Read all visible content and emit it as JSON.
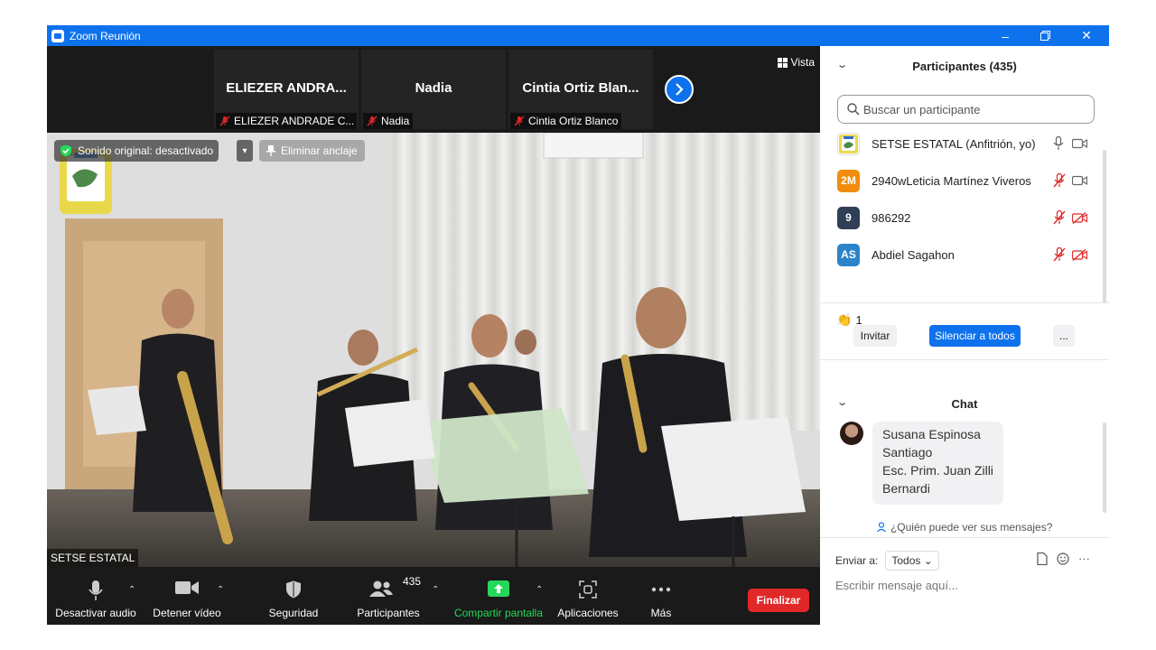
{
  "window": {
    "title": "Zoom Reunión"
  },
  "thumbnails": [
    {
      "display_name": "ELIEZER ANDRA...",
      "label": "ELIEZER ANDRADE C..."
    },
    {
      "display_name": "Nadia",
      "label": "Nadia"
    },
    {
      "display_name": "Cintia Ortiz Blan...",
      "label": "Cintia Ortiz Blanco"
    }
  ],
  "view_button": "Vista",
  "main_video": {
    "sound_status": "Sonido original: desactivado",
    "unpin_label": "Eliminar anclaje",
    "speaker_name": "SETSE ESTATAL"
  },
  "toolbar": {
    "mute_audio": "Desactivar audio",
    "stop_video": "Detener vídeo",
    "security": "Seguridad",
    "participants": "Participantes",
    "participants_count": "435",
    "share_screen": "Compartir pantalla",
    "apps": "Aplicaciones",
    "more": "Más",
    "end": "Finalizar"
  },
  "participants_panel": {
    "title": "Participantes (435)",
    "search_placeholder": "Buscar un participante",
    "participants": [
      {
        "initials": "",
        "name": "SETSE ESTATAL (Anfitrión, yo)",
        "avatar_color": "#8db04a"
      },
      {
        "initials": "2M",
        "name": "2940wLeticia Martínez Viveros",
        "avatar_color": "#f28c0f"
      },
      {
        "initials": "9",
        "name": "986292",
        "avatar_color": "#2f3f55"
      },
      {
        "initials": "AS",
        "name": "Abdiel Sagahon",
        "avatar_color": "#2b83c9"
      }
    ],
    "reaction_count": "1",
    "invite_button": "Invitar",
    "mute_all_button": "Silenciar a todos",
    "more_button": "..."
  },
  "chat_panel": {
    "title": "Chat",
    "message_text": "Susana Espinosa Santiago\nEsc. Prim. Juan Zilli Bernardi",
    "who_can_see": "¿Quién puede ver sus mensajes?",
    "send_to_label": "Enviar a:",
    "send_to_value": "Todos",
    "input_placeholder": "Escribir mensaje aquí..."
  },
  "colors": {
    "title_bar": "#0e72ed",
    "accent_blue": "#0e72ed",
    "end_button": "#e02828",
    "share_green": "#23d959",
    "muted_red": "#e02828"
  }
}
